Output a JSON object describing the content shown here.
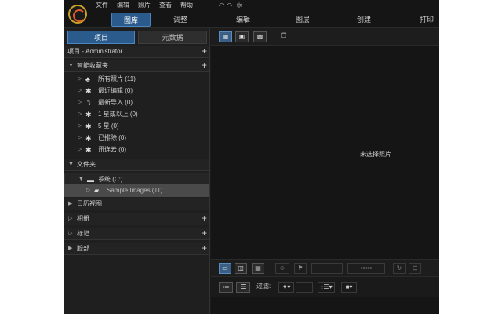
{
  "menu": [
    "文件",
    "编辑",
    "照片",
    "查看",
    "帮助"
  ],
  "toolbar_icons": [
    "undo-icon",
    "redo-icon",
    "settings-icon"
  ],
  "nav_tabs": [
    {
      "label": "图库",
      "active": true
    },
    {
      "label": "调整",
      "active": false
    },
    {
      "label": "编辑",
      "active": false
    },
    {
      "label": "图层",
      "active": false
    },
    {
      "label": "创建",
      "active": false
    },
    {
      "label": "打印",
      "active": false
    }
  ],
  "panel_tabs": {
    "projects": "项目",
    "metadata": "元数据"
  },
  "project_header": "项目 - Administrator",
  "smart_collections": {
    "header": "智能收藏夹",
    "items": [
      {
        "label": "所有照片 (11)",
        "icon": "photos-icon"
      },
      {
        "label": "最近编辑 (0)",
        "icon": "magic-wand-icon"
      },
      {
        "label": "最新导入 (0)",
        "icon": "import-icon"
      },
      {
        "label": "1 星或以上 (0)",
        "icon": "magic-wand-icon"
      },
      {
        "label": "5 星 (0)",
        "icon": "magic-wand-icon"
      },
      {
        "label": "已排除 (0)",
        "icon": "magic-wand-icon"
      },
      {
        "label": "讯连云 (0)",
        "icon": "magic-wand-icon"
      }
    ]
  },
  "folders": {
    "header": "文件夹",
    "drive": "系统 (C:)",
    "folder": "Sample Images (11)"
  },
  "calendar_view": "日历视图",
  "albums": "相册",
  "tags": "标记",
  "faces": "脸部",
  "content": {
    "empty_message": "未选择照片"
  },
  "filter_label": "过滤:",
  "colors": {
    "accent": "#2b5b8c",
    "background": "#1b1b1b",
    "panel": "#1f1f1f"
  }
}
